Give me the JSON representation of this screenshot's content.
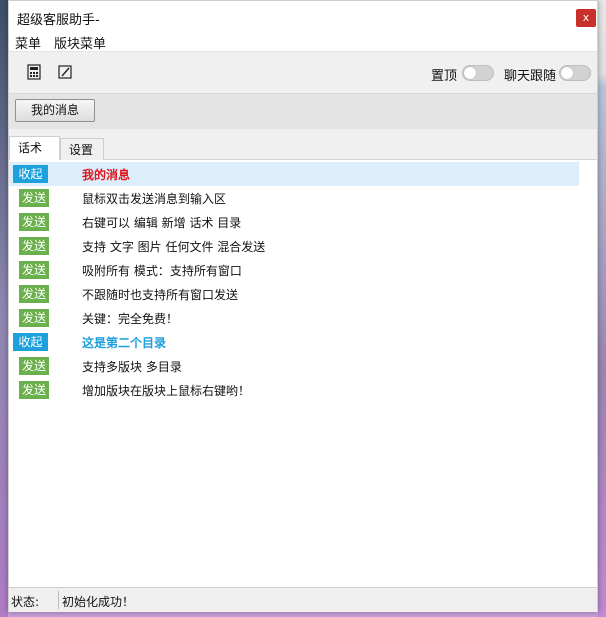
{
  "window": {
    "title": "超级客服助手-",
    "close_label": "x"
  },
  "menu": {
    "items": [
      {
        "label": "菜单"
      },
      {
        "label": "版块菜单"
      }
    ]
  },
  "toolbar": {
    "icons": [
      "calculator-icon",
      "edit-icon"
    ],
    "toggles": [
      {
        "label": "置顶",
        "on": false
      },
      {
        "label": "聊天跟随",
        "on": false
      }
    ]
  },
  "block": {
    "button_label": "我的消息"
  },
  "tabs": [
    {
      "label": "话术",
      "active": true
    },
    {
      "label": "设置",
      "active": false
    }
  ],
  "list": [
    {
      "badge": "收起",
      "badge_type": "collapse",
      "text": "我的消息",
      "style": "header-red",
      "highlight": true
    },
    {
      "badge": "发送",
      "badge_type": "send",
      "text": "鼠标双击发送消息到输入区"
    },
    {
      "badge": "发送",
      "badge_type": "send",
      "text": "右键可以 编辑 新增 话术 目录"
    },
    {
      "badge": "发送",
      "badge_type": "send",
      "text": "支持 文字 图片 任何文件 混合发送"
    },
    {
      "badge": "发送",
      "badge_type": "send",
      "text": "吸附所有 模式：支持所有窗口"
    },
    {
      "badge": "发送",
      "badge_type": "send",
      "text": "不跟随时也支持所有窗口发送"
    },
    {
      "badge": "发送",
      "badge_type": "send",
      "text": "关键：完全免费！"
    },
    {
      "badge": "收起",
      "badge_type": "collapse",
      "text": "这是第二个目录",
      "style": "header-blue"
    },
    {
      "badge": "发送",
      "badge_type": "send",
      "text": "支持多版块 多目录"
    },
    {
      "badge": "发送",
      "badge_type": "send",
      "text": "增加版块在版块上鼠标右键哟！"
    }
  ],
  "status": {
    "label": "状态:",
    "value": "初始化成功！"
  },
  "colors": {
    "collapse_badge": "#1ea0dc",
    "send_badge": "#6ab04c",
    "header_red": "#e0161c",
    "header_blue": "#1ea0dc",
    "row_highlight": "#dceefc"
  }
}
